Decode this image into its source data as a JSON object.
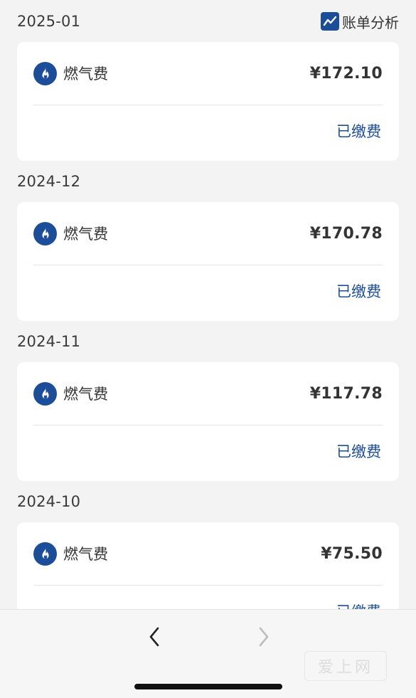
{
  "header": {
    "analysis_label": "账单分析",
    "analysis_icon": "trend-chart-icon"
  },
  "bills": [
    {
      "month": "2025-01",
      "fee_name": "燃气费",
      "amount": "¥172.10",
      "status": "已缴费",
      "icon": "flame-icon"
    },
    {
      "month": "2024-12",
      "fee_name": "燃气费",
      "amount": "¥170.78",
      "status": "已缴费",
      "icon": "flame-icon"
    },
    {
      "month": "2024-11",
      "fee_name": "燃气费",
      "amount": "¥117.78",
      "status": "已缴费",
      "icon": "flame-icon"
    },
    {
      "month": "2024-10",
      "fee_name": "燃气费",
      "amount": "¥75.50",
      "status": "已缴费",
      "icon": "flame-icon"
    }
  ],
  "bottom_bar": {
    "back_icon": "chevron-left-icon",
    "forward_icon": "chevron-right-icon",
    "watermark": "爱上网"
  },
  "colors": {
    "accent": "#1b4d99",
    "background": "#f3f3f3",
    "card": "#ffffff"
  }
}
